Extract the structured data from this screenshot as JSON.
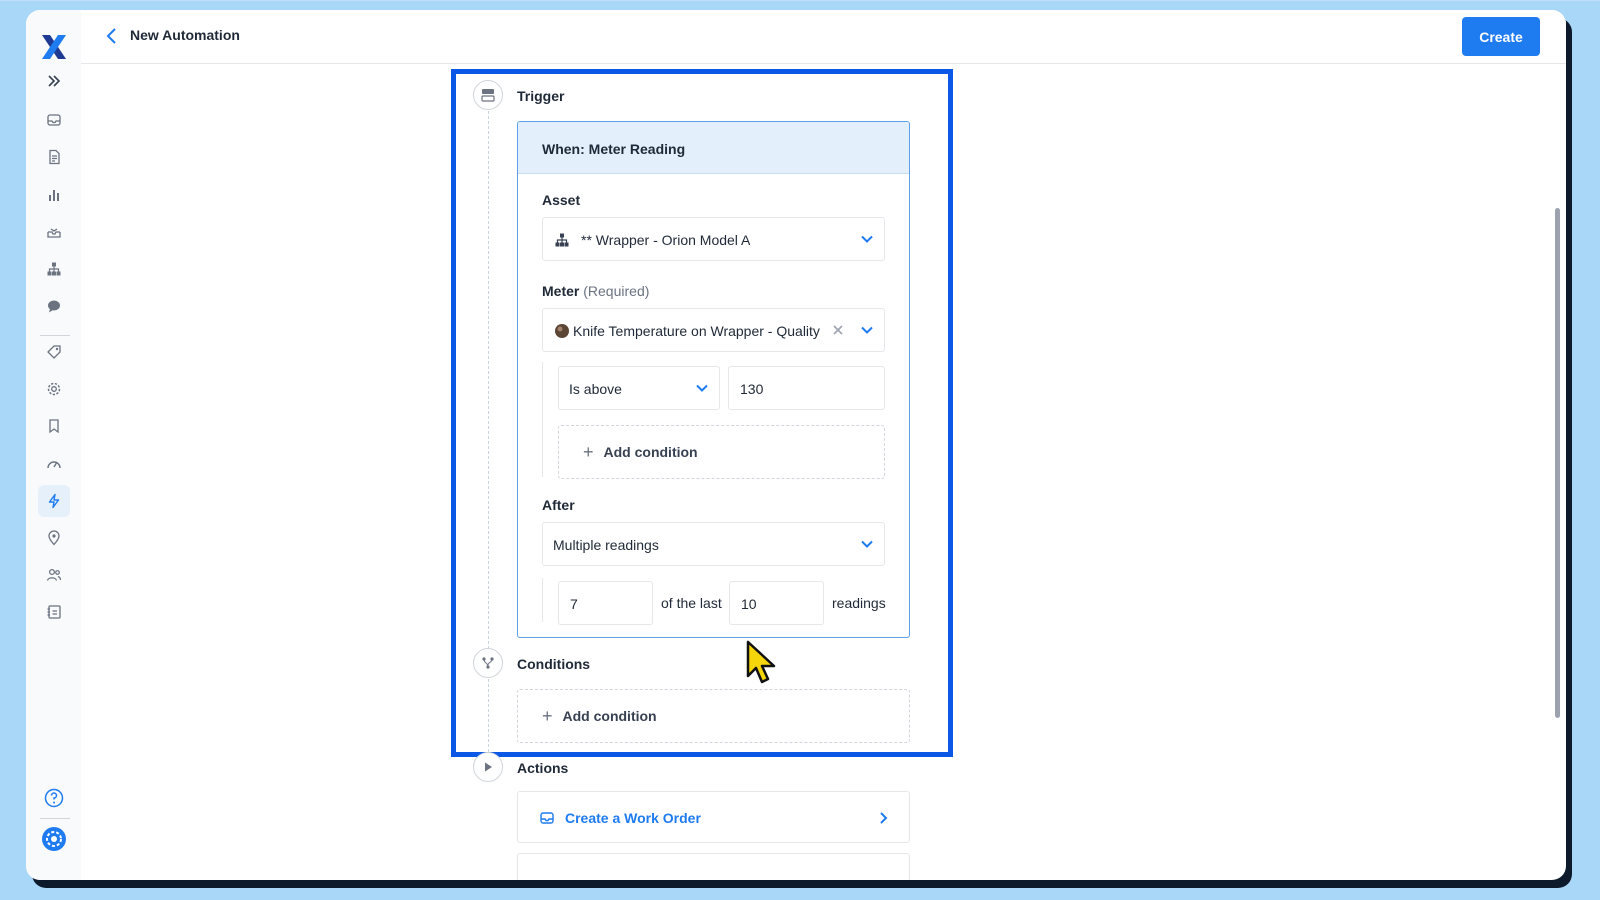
{
  "header": {
    "title": "New Automation",
    "create_label": "Create"
  },
  "sidebar": {
    "items": [
      {
        "icon": "expand-icon"
      },
      {
        "icon": "inbox-icon"
      },
      {
        "icon": "document-icon"
      },
      {
        "icon": "bar-chart-icon"
      },
      {
        "icon": "tray-icon"
      },
      {
        "icon": "hierarchy-icon"
      },
      {
        "icon": "chat-icon"
      },
      {
        "icon": "tag-icon"
      },
      {
        "icon": "gear-icon"
      },
      {
        "icon": "bookmark-icon"
      },
      {
        "icon": "gauge-icon"
      },
      {
        "icon": "lightning-icon",
        "active": true
      },
      {
        "icon": "location-pin-icon"
      },
      {
        "icon": "users-icon"
      },
      {
        "icon": "vendor-icon"
      }
    ],
    "help_icon": "help-icon",
    "org_icon": "organization-avatar"
  },
  "trigger": {
    "label": "Trigger",
    "card_title": "When: Meter Reading",
    "asset": {
      "label": "Asset",
      "value": "** Wrapper - Orion Model A"
    },
    "meter": {
      "label": "Meter",
      "required": "(Required)",
      "value": "Knife Temperature on Wrapper - Quality"
    },
    "condition": {
      "operator": "Is above",
      "value": "130",
      "add_label": "Add condition"
    },
    "after": {
      "label": "After",
      "value": "Multiple readings",
      "count": "7",
      "of_the_last": "of the last",
      "total": "10",
      "readings": "readings"
    }
  },
  "conditions": {
    "label": "Conditions",
    "add_label": "Add condition"
  },
  "actions": {
    "label": "Actions",
    "first_action": "Create a Work Order"
  },
  "colors": {
    "accent": "#1e7bf0",
    "highlight": "#0b57e6",
    "card_header": "#e3f0fc"
  }
}
